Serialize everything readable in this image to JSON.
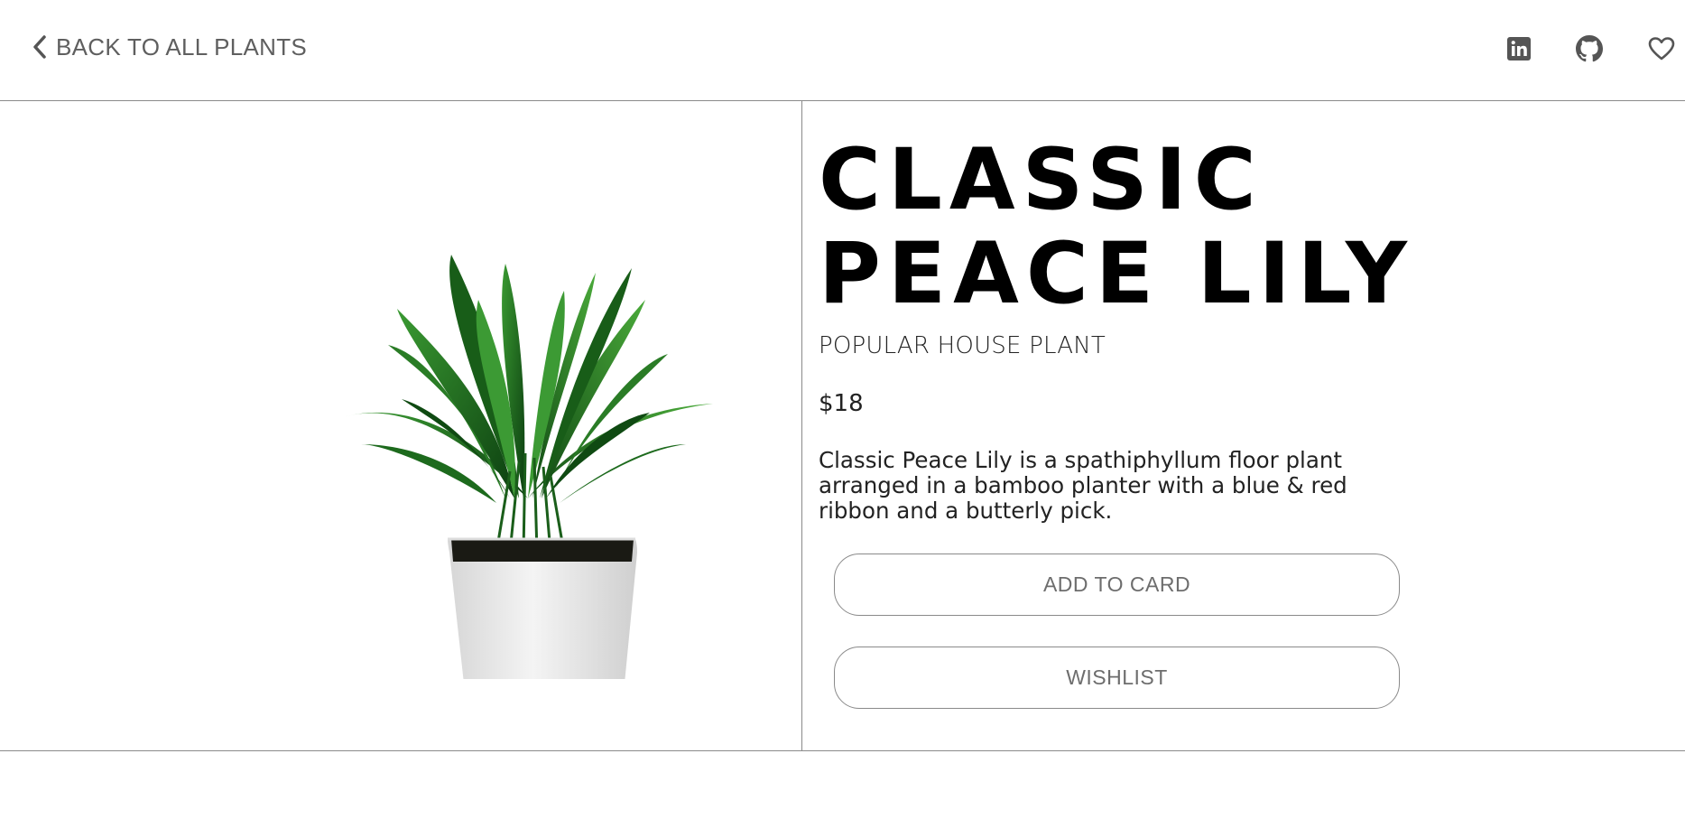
{
  "header": {
    "back_label": "BACK TO ALL PLANTS",
    "icons": [
      "chevron-left-icon",
      "linkedin-icon",
      "github-icon",
      "heart-icon"
    ]
  },
  "product": {
    "title_line1": "CLASSIC",
    "title_line2": "PEACE LILY",
    "category": "POPULAR HOUSE PLANT",
    "price": "$18",
    "description": "Classic Peace Lily is a spathiphyllum floor plant arranged in a bamboo planter with a blue & red ribbon and a butterly pick.",
    "add_label": "ADD TO CARD",
    "wishlist_label": "WISHLIST"
  },
  "colors": {
    "icon": "#555555",
    "border": "#8a8a8a",
    "leaf_dark": "#0f4a12",
    "leaf_light": "#2f8a2a",
    "pot": "#e8e8e8"
  }
}
